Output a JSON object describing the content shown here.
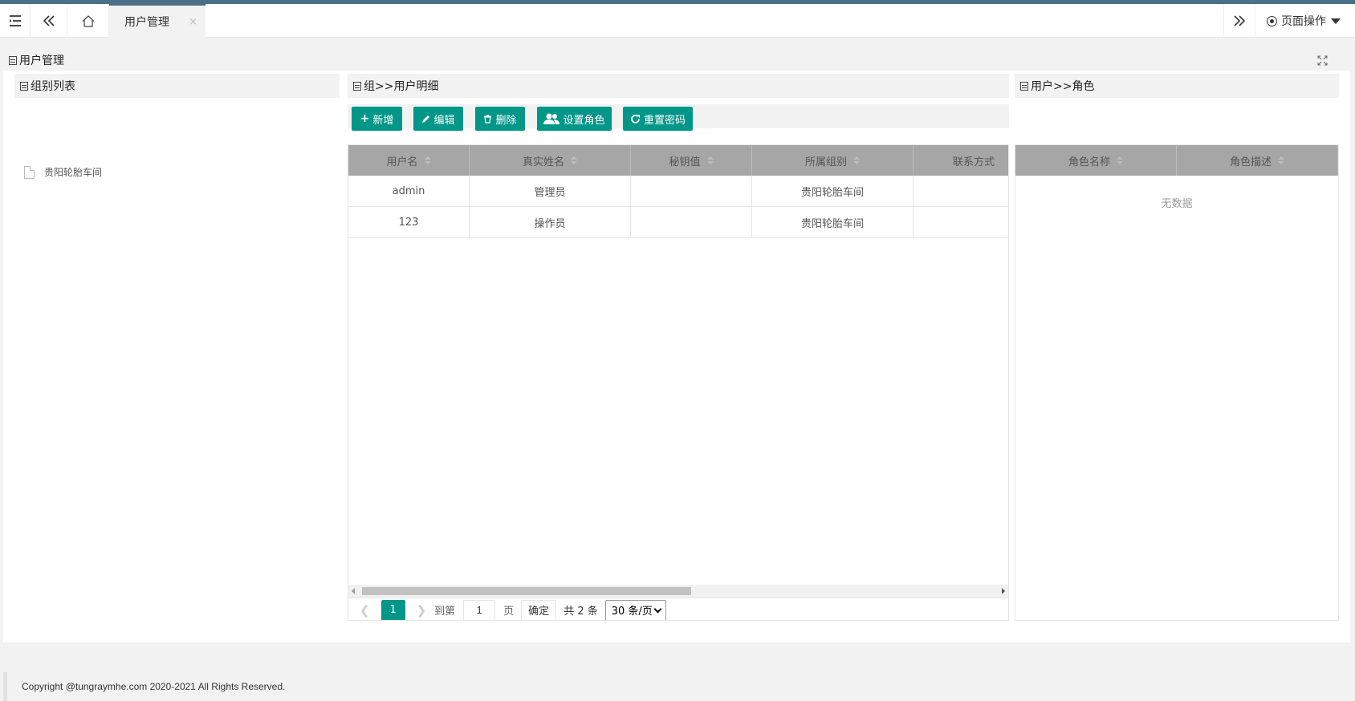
{
  "topbar": {
    "tab_label": "用户管理",
    "tab_close": "×",
    "page_ops_label": "页面操作"
  },
  "main": {
    "title": "用户管理"
  },
  "groups": {
    "title": "组别列表",
    "items": [
      "贵阳轮胎车间"
    ]
  },
  "users": {
    "title": "组>>用户明细",
    "buttons": {
      "add": "新增",
      "edit": "编辑",
      "delete": "删除",
      "set_role": "设置角色",
      "reset_pwd": "重置密码"
    },
    "columns": [
      "用户名",
      "真实姓名",
      "秘钥值",
      "所属组别",
      "联系方式"
    ],
    "rows": [
      [
        "admin",
        "管理员",
        "",
        "贵阳轮胎车间",
        ""
      ],
      [
        "123",
        "操作员",
        "",
        "贵阳轮胎车间",
        ""
      ]
    ],
    "pager": {
      "current": "1",
      "goto_label": "到第",
      "goto_value": "1",
      "page_unit": "页",
      "ok": "确定",
      "total": "共 2 条",
      "page_size": "30 条/页"
    }
  },
  "roles": {
    "title": "用户>>角色",
    "columns": [
      "角色名称",
      "角色描述"
    ],
    "empty_text": "无数据"
  },
  "footer": {
    "copyright": "Copyright @tungraymhe.com 2020-2021 All Rights Reserved."
  },
  "colors": {
    "accent": "#009688",
    "topline": "#4b6f86",
    "header_gray": "#a6a6a6"
  }
}
